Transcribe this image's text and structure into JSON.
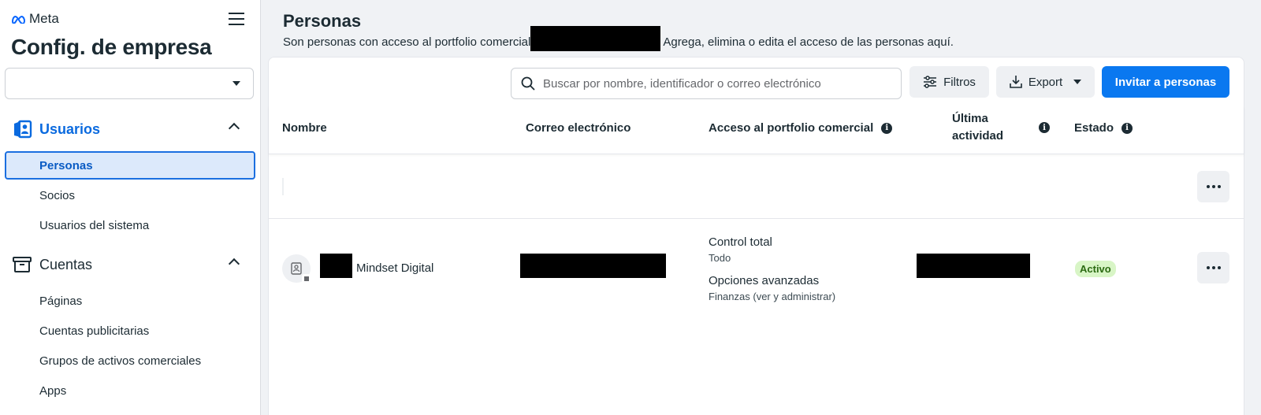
{
  "brand": {
    "logo_text": "Meta"
  },
  "sidebar": {
    "app_title": "Config. de empresa",
    "account_select_value": "",
    "sections": [
      {
        "label": "Usuarios",
        "icon": "user-badge-icon",
        "expanded": true,
        "items": [
          {
            "label": "Personas",
            "active": true
          },
          {
            "label": "Socios"
          },
          {
            "label": "Usuarios del sistema"
          }
        ]
      },
      {
        "label": "Cuentas",
        "icon": "accounts-box-icon",
        "expanded": true,
        "items": [
          {
            "label": "Páginas"
          },
          {
            "label": "Cuentas publicitarias"
          },
          {
            "label": "Grupos de activos comerciales"
          },
          {
            "label": "Apps"
          }
        ]
      }
    ]
  },
  "main": {
    "title": "Personas",
    "subtitle_before": "Son personas con acceso al portfolio comercial",
    "subtitle_after": "Agrega, elimina o edita el acceso de las personas aquí."
  },
  "toolbar": {
    "search_placeholder": "Buscar por nombre, identificador o correo electrónico",
    "filters_label": "Filtros",
    "export_label": "Export",
    "invite_label": "Invitar a personas"
  },
  "table": {
    "columns": {
      "name": "Nombre",
      "email": "Correo electrónico",
      "access": "Acceso al portfolio comercial",
      "last_activity": "Última actividad",
      "status": "Estado"
    },
    "rows": [
      {
        "name": "Mindset Digital",
        "access": [
          {
            "title": "Control total",
            "detail": "Todo"
          },
          {
            "title": "Opciones avanzadas",
            "detail": "Finanzas (ver y administrar)"
          }
        ],
        "status": "Activo"
      }
    ]
  },
  "colors": {
    "primary": "#0a78f0",
    "active_nav_bg": "#dce9fb",
    "status_active_bg": "#d8f5c6",
    "status_active_text": "#2b6a12"
  }
}
